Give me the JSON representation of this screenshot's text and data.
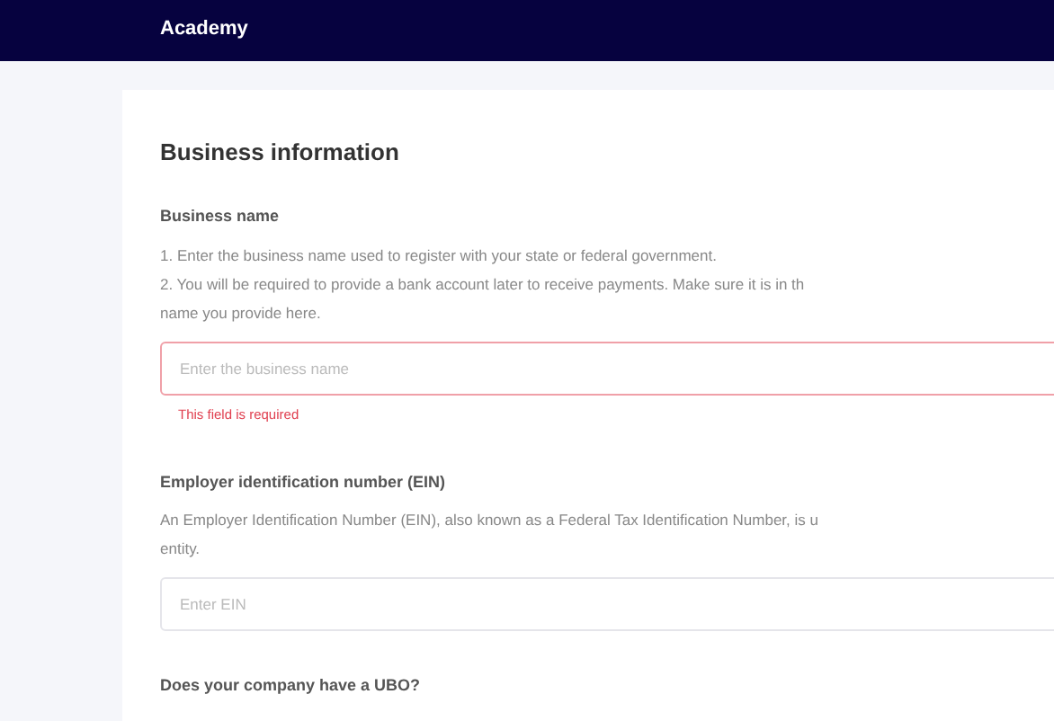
{
  "header": {
    "title": "Academy"
  },
  "section": {
    "title": "Business information"
  },
  "fields": [
    {
      "label": "Business name",
      "help_lines": [
        "1. Enter the business name used to register with your state or federal government.",
        "2. You will be required to provide a bank account later to receive payments. Make sure it is in th",
        "name you provide here."
      ],
      "placeholder": "Enter the business name",
      "invalid": true,
      "error": "This field is required"
    },
    {
      "label": "Employer identification number (EIN)",
      "help_lines": [
        "An Employer Identification Number (EIN), also known as a Federal Tax Identification Number, is u",
        "entity."
      ],
      "placeholder": "Enter EIN",
      "invalid": false
    }
  ],
  "next_question": {
    "label": "Does your company have a UBO?"
  }
}
